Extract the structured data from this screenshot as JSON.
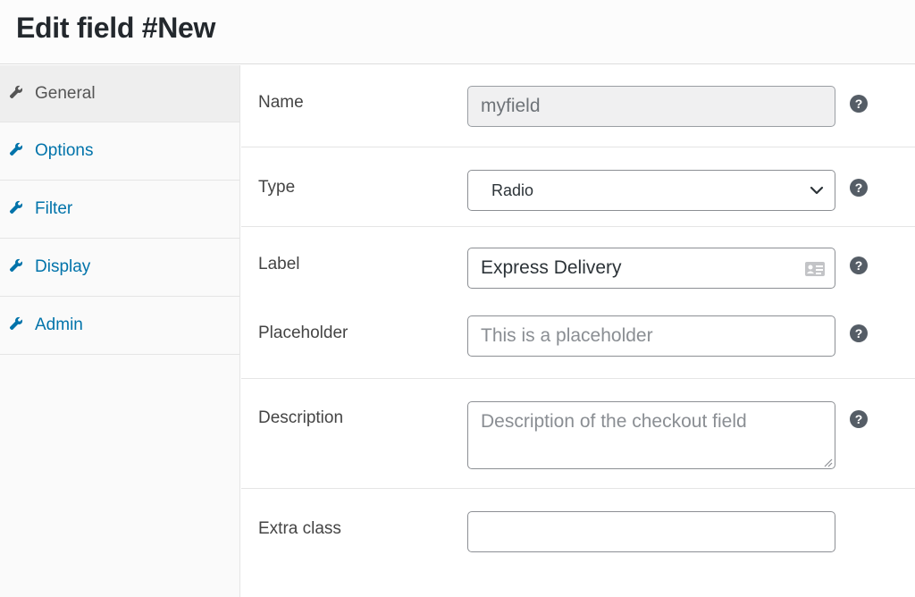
{
  "header": {
    "title": "Edit field #New"
  },
  "sidebar": {
    "items": [
      {
        "label": "General",
        "icon": "wrench-icon",
        "active": true
      },
      {
        "label": "Options",
        "icon": "wrench-icon",
        "active": false
      },
      {
        "label": "Filter",
        "icon": "wrench-icon",
        "active": false
      },
      {
        "label": "Display",
        "icon": "wrench-icon",
        "active": false
      },
      {
        "label": "Admin",
        "icon": "wrench-icon",
        "active": false
      }
    ]
  },
  "form": {
    "name": {
      "label": "Name",
      "value": "myfield"
    },
    "type": {
      "label": "Type",
      "value": "Radio"
    },
    "label": {
      "label": "Label",
      "value": "Express Delivery"
    },
    "placeholder": {
      "label": "Placeholder",
      "placeholder": "This is a placeholder"
    },
    "description": {
      "label": "Description",
      "placeholder": "Description of the checkout field"
    },
    "extra_class": {
      "label": "Extra class",
      "value": ""
    },
    "help_glyph": "?"
  },
  "colors": {
    "link": "#0073aa",
    "active_tab_text": "#555555",
    "help_icon": "#555d66",
    "border": "#8c8f94"
  }
}
